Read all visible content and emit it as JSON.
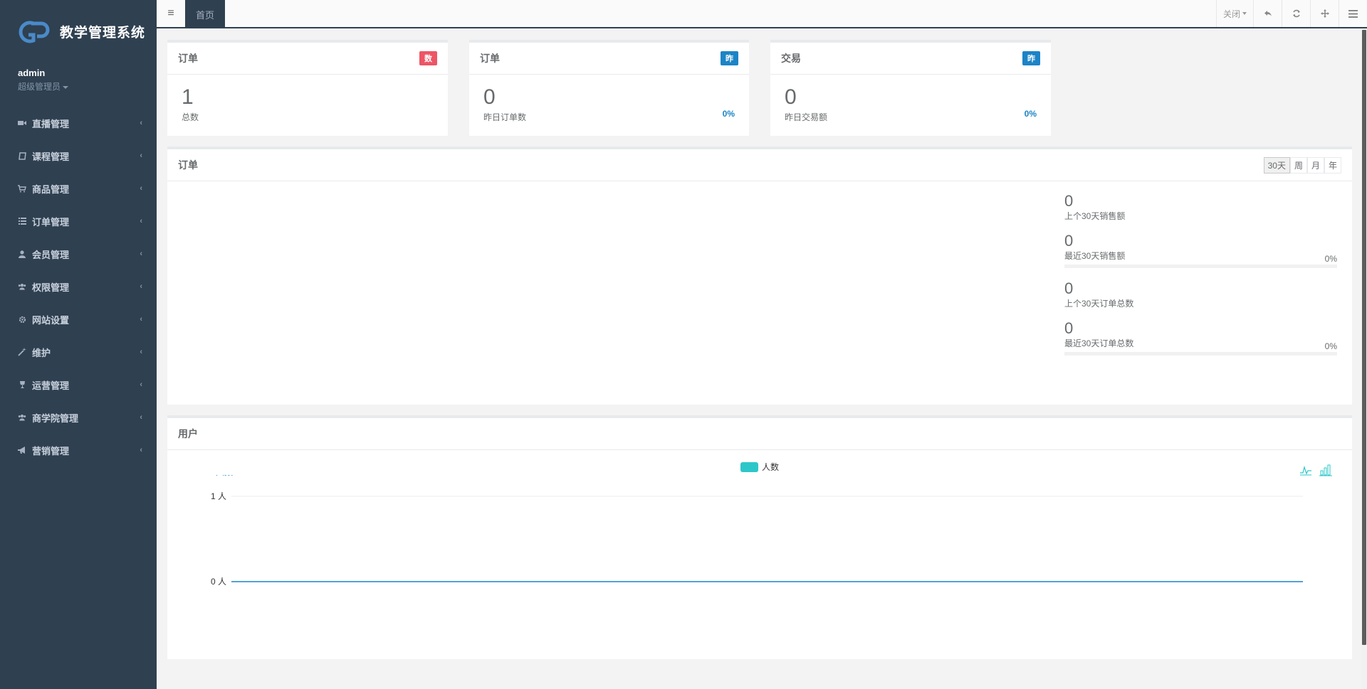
{
  "app": {
    "brand_title": "教学管理系统",
    "user_name": "admin",
    "user_role": "超级管理员"
  },
  "sidebar": {
    "items": [
      {
        "label": "直播管理",
        "icon": "video-camera-icon"
      },
      {
        "label": "课程管理",
        "icon": "book-icon"
      },
      {
        "label": "商品管理",
        "icon": "shopping-cart-icon"
      },
      {
        "label": "订单管理",
        "icon": "list-icon"
      },
      {
        "label": "会员管理",
        "icon": "user-icon"
      },
      {
        "label": "权限管理",
        "icon": "users-icon"
      },
      {
        "label": "网站设置",
        "icon": "gear-icon"
      },
      {
        "label": "维护",
        "icon": "magic-wand-icon"
      },
      {
        "label": "运营管理",
        "icon": "trophy-icon"
      },
      {
        "label": "商学院管理",
        "icon": "users-icon"
      },
      {
        "label": "营销管理",
        "icon": "bullhorn-icon"
      }
    ]
  },
  "topbar": {
    "home_tab": "首页",
    "close_label": "关闭"
  },
  "stats": [
    {
      "title": "订单",
      "badge": "数",
      "badge_color": "#ed5565",
      "value": "1",
      "desc": "总数",
      "pct": ""
    },
    {
      "title": "订单",
      "badge": "昨",
      "badge_color": "#1c84c6",
      "value": "0",
      "desc": "昨日订单数",
      "pct": "0%"
    },
    {
      "title": "交易",
      "badge": "昨",
      "badge_color": "#1c84c6",
      "value": "0",
      "desc": "昨日交易额",
      "pct": "0%"
    }
  ],
  "orders": {
    "title": "订单",
    "ranges": [
      "30天",
      "周",
      "月",
      "年"
    ],
    "active_range": "30天",
    "summary": [
      {
        "value": "0",
        "label": "上个30天销售额",
        "pct": "",
        "progress": 0
      },
      {
        "value": "0",
        "label": "最近30天销售额",
        "pct": "0%",
        "progress": 0
      },
      {
        "value": "0",
        "label": "上个30天订单总数",
        "pct": "",
        "progress": 0
      },
      {
        "value": "0",
        "label": "最近30天订单总数",
        "pct": "0%",
        "progress": 0
      }
    ]
  },
  "users": {
    "title": "用户",
    "legend": "人数"
  },
  "chart_data": {
    "type": "line",
    "title": "",
    "ylabel": "人数",
    "y_ticks": [
      "0 人",
      "1 人"
    ],
    "ylim": [
      0,
      1
    ],
    "series": [
      {
        "name": "人数",
        "values": [
          0,
          0
        ],
        "color": "#1c84c6"
      }
    ]
  }
}
